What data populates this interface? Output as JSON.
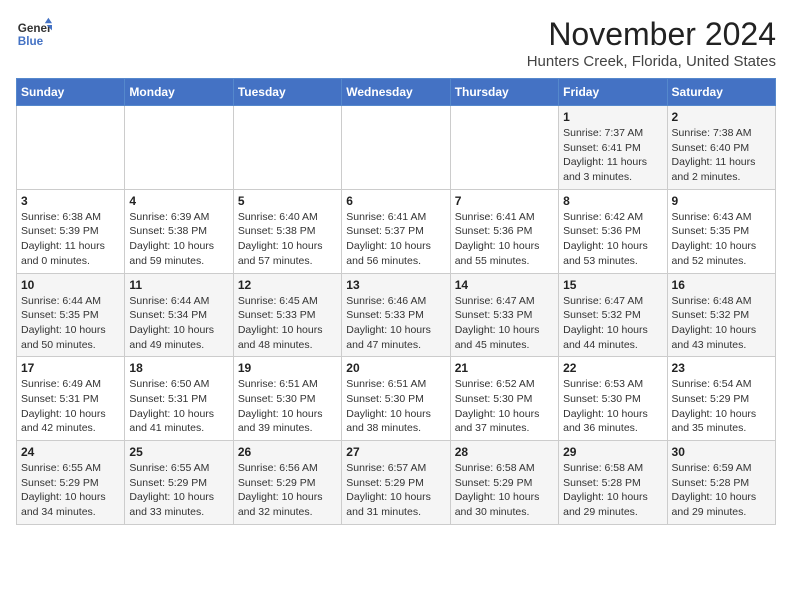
{
  "header": {
    "logo": {
      "line1": "General",
      "line2": "Blue"
    },
    "title": "November 2024",
    "subtitle": "Hunters Creek, Florida, United States"
  },
  "calendar": {
    "weekdays": [
      "Sunday",
      "Monday",
      "Tuesday",
      "Wednesday",
      "Thursday",
      "Friday",
      "Saturday"
    ],
    "weeks": [
      [
        {
          "day": "",
          "info": ""
        },
        {
          "day": "",
          "info": ""
        },
        {
          "day": "",
          "info": ""
        },
        {
          "day": "",
          "info": ""
        },
        {
          "day": "",
          "info": ""
        },
        {
          "day": "1",
          "info": "Sunrise: 7:37 AM\nSunset: 6:41 PM\nDaylight: 11 hours and 3 minutes."
        },
        {
          "day": "2",
          "info": "Sunrise: 7:38 AM\nSunset: 6:40 PM\nDaylight: 11 hours and 2 minutes."
        }
      ],
      [
        {
          "day": "3",
          "info": "Sunrise: 6:38 AM\nSunset: 5:39 PM\nDaylight: 11 hours and 0 minutes."
        },
        {
          "day": "4",
          "info": "Sunrise: 6:39 AM\nSunset: 5:38 PM\nDaylight: 10 hours and 59 minutes."
        },
        {
          "day": "5",
          "info": "Sunrise: 6:40 AM\nSunset: 5:38 PM\nDaylight: 10 hours and 57 minutes."
        },
        {
          "day": "6",
          "info": "Sunrise: 6:41 AM\nSunset: 5:37 PM\nDaylight: 10 hours and 56 minutes."
        },
        {
          "day": "7",
          "info": "Sunrise: 6:41 AM\nSunset: 5:36 PM\nDaylight: 10 hours and 55 minutes."
        },
        {
          "day": "8",
          "info": "Sunrise: 6:42 AM\nSunset: 5:36 PM\nDaylight: 10 hours and 53 minutes."
        },
        {
          "day": "9",
          "info": "Sunrise: 6:43 AM\nSunset: 5:35 PM\nDaylight: 10 hours and 52 minutes."
        }
      ],
      [
        {
          "day": "10",
          "info": "Sunrise: 6:44 AM\nSunset: 5:35 PM\nDaylight: 10 hours and 50 minutes."
        },
        {
          "day": "11",
          "info": "Sunrise: 6:44 AM\nSunset: 5:34 PM\nDaylight: 10 hours and 49 minutes."
        },
        {
          "day": "12",
          "info": "Sunrise: 6:45 AM\nSunset: 5:33 PM\nDaylight: 10 hours and 48 minutes."
        },
        {
          "day": "13",
          "info": "Sunrise: 6:46 AM\nSunset: 5:33 PM\nDaylight: 10 hours and 47 minutes."
        },
        {
          "day": "14",
          "info": "Sunrise: 6:47 AM\nSunset: 5:33 PM\nDaylight: 10 hours and 45 minutes."
        },
        {
          "day": "15",
          "info": "Sunrise: 6:47 AM\nSunset: 5:32 PM\nDaylight: 10 hours and 44 minutes."
        },
        {
          "day": "16",
          "info": "Sunrise: 6:48 AM\nSunset: 5:32 PM\nDaylight: 10 hours and 43 minutes."
        }
      ],
      [
        {
          "day": "17",
          "info": "Sunrise: 6:49 AM\nSunset: 5:31 PM\nDaylight: 10 hours and 42 minutes."
        },
        {
          "day": "18",
          "info": "Sunrise: 6:50 AM\nSunset: 5:31 PM\nDaylight: 10 hours and 41 minutes."
        },
        {
          "day": "19",
          "info": "Sunrise: 6:51 AM\nSunset: 5:30 PM\nDaylight: 10 hours and 39 minutes."
        },
        {
          "day": "20",
          "info": "Sunrise: 6:51 AM\nSunset: 5:30 PM\nDaylight: 10 hours and 38 minutes."
        },
        {
          "day": "21",
          "info": "Sunrise: 6:52 AM\nSunset: 5:30 PM\nDaylight: 10 hours and 37 minutes."
        },
        {
          "day": "22",
          "info": "Sunrise: 6:53 AM\nSunset: 5:30 PM\nDaylight: 10 hours and 36 minutes."
        },
        {
          "day": "23",
          "info": "Sunrise: 6:54 AM\nSunset: 5:29 PM\nDaylight: 10 hours and 35 minutes."
        }
      ],
      [
        {
          "day": "24",
          "info": "Sunrise: 6:55 AM\nSunset: 5:29 PM\nDaylight: 10 hours and 34 minutes."
        },
        {
          "day": "25",
          "info": "Sunrise: 6:55 AM\nSunset: 5:29 PM\nDaylight: 10 hours and 33 minutes."
        },
        {
          "day": "26",
          "info": "Sunrise: 6:56 AM\nSunset: 5:29 PM\nDaylight: 10 hours and 32 minutes."
        },
        {
          "day": "27",
          "info": "Sunrise: 6:57 AM\nSunset: 5:29 PM\nDaylight: 10 hours and 31 minutes."
        },
        {
          "day": "28",
          "info": "Sunrise: 6:58 AM\nSunset: 5:29 PM\nDaylight: 10 hours and 30 minutes."
        },
        {
          "day": "29",
          "info": "Sunrise: 6:58 AM\nSunset: 5:28 PM\nDaylight: 10 hours and 29 minutes."
        },
        {
          "day": "30",
          "info": "Sunrise: 6:59 AM\nSunset: 5:28 PM\nDaylight: 10 hours and 29 minutes."
        }
      ]
    ]
  }
}
